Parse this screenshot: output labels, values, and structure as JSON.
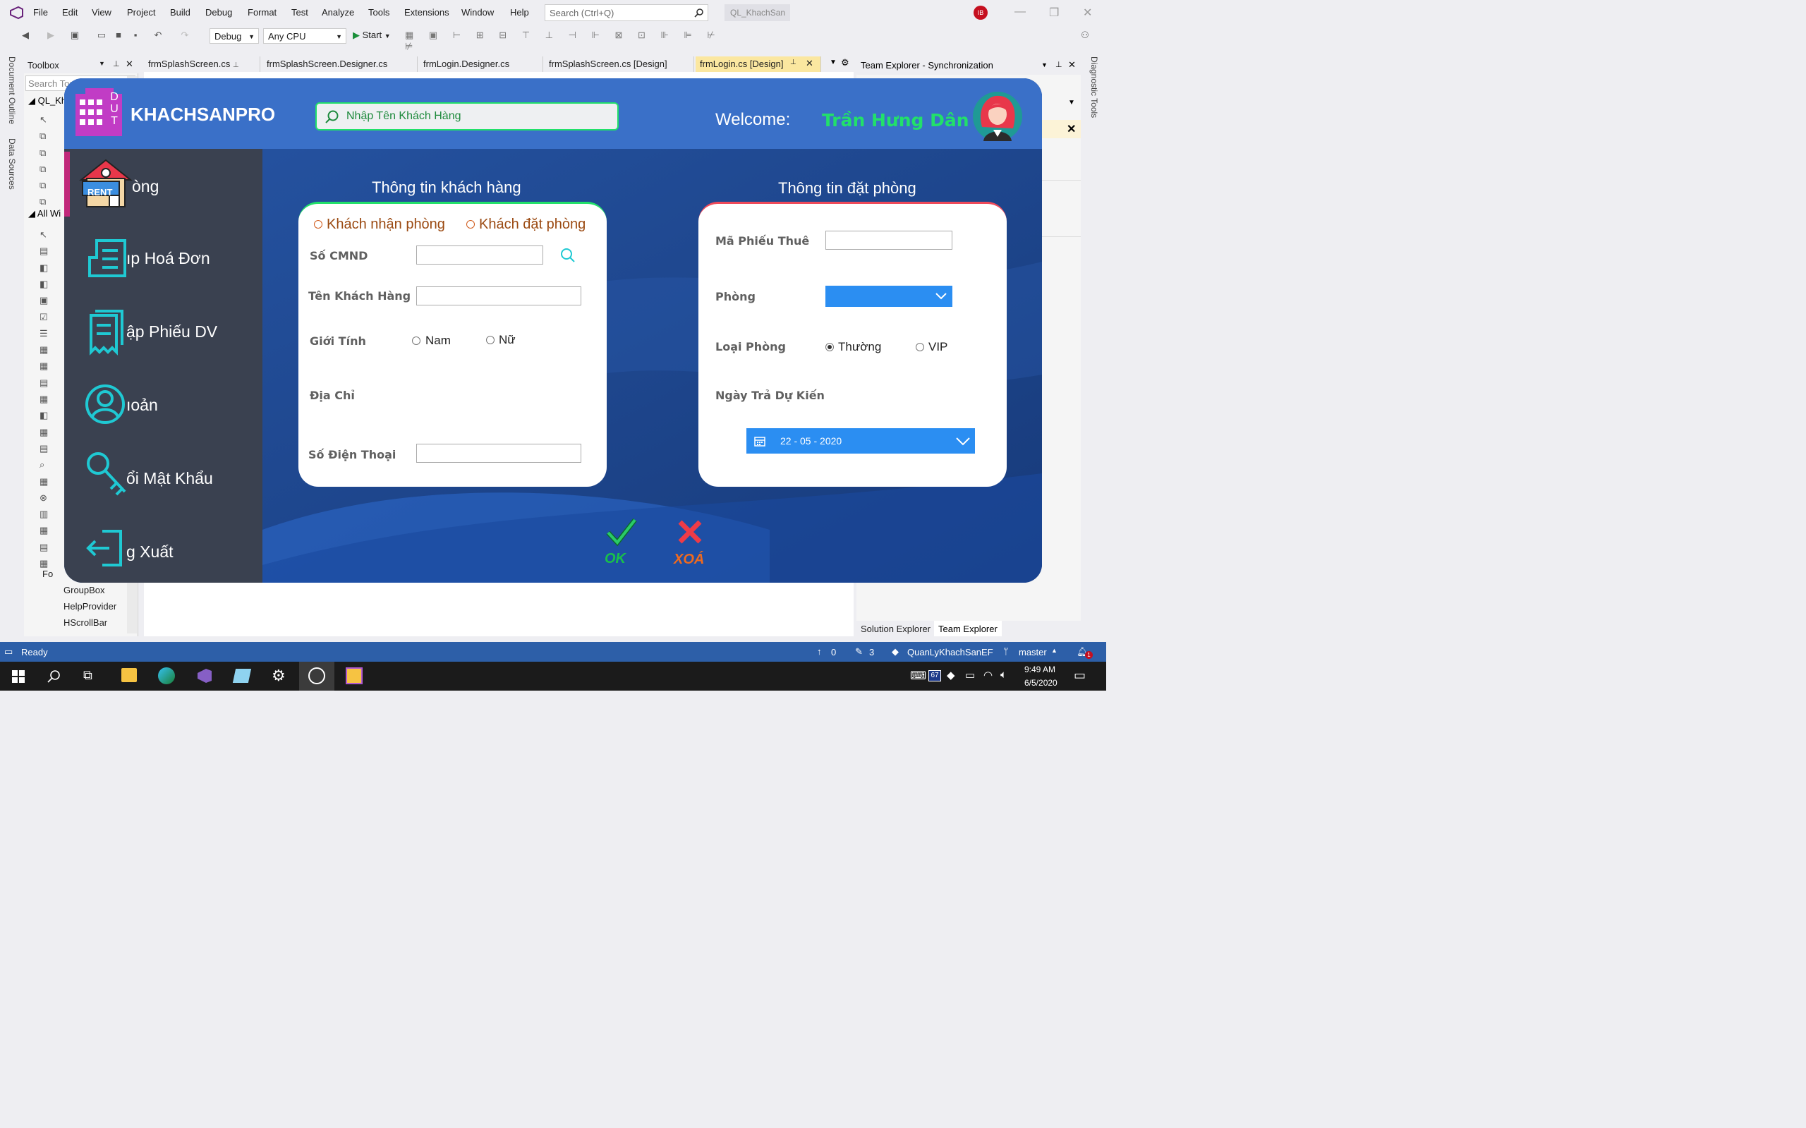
{
  "vs": {
    "menu": [
      "File",
      "Edit",
      "View",
      "Project",
      "Build",
      "Debug",
      "Format",
      "Test",
      "Analyze",
      "Tools",
      "Extensions",
      "Window",
      "Help"
    ],
    "search_placeholder": "Search (Ctrl+Q)",
    "project_name": "QL_KhachSan",
    "account_initials": "IB",
    "config": "Debug",
    "platform": "Any CPU",
    "start_label": "Start",
    "left_rail": [
      "Document Outline",
      "Data Sources"
    ],
    "right_rail": "Diagnostic Tools",
    "toolbox": {
      "title": "Toolbox",
      "search_placeholder": "Search Toolbox",
      "group1": "QL_Kh",
      "group2": "All Wi",
      "items": [
        "Fo",
        "GroupBox",
        "HelpProvider",
        "HScrollBar"
      ]
    },
    "tabs": [
      "frmSplashScreen.cs",
      "frmSplashScreen.Designer.cs",
      "frmLogin.Designer.cs",
      "frmSplashScreen.cs [Design]",
      "frmLogin.cs [Design]"
    ],
    "team_explorer": {
      "title": "Team Explorer - Synchronization"
    },
    "bottom_tabs": [
      "Solution Explorer",
      "Team Explorer"
    ],
    "status": {
      "ready": "Ready",
      "up_count": "0",
      "edit_count": "3",
      "repo": "QuanLyKhachSanEF",
      "branch": "master",
      "notifications": "1"
    },
    "taskbar": {
      "time": "9:49 AM",
      "date": "6/5/2020",
      "badge": "67"
    }
  },
  "form": {
    "brand": "KHACHSANPRO",
    "logo_letters": "DUT",
    "search_placeholder": "Nhập Tên Khách Hàng",
    "welcome_label": "Welcome:",
    "user_name": "Trần Hưng Dân",
    "nav": [
      {
        "label": "òng",
        "icon": "rent-house-icon",
        "badge": "RENT"
      },
      {
        "label": "ıp Hoá Đơn",
        "icon": "invoice-icon"
      },
      {
        "label": "ập Phiếu DV",
        "icon": "receipt-icon"
      },
      {
        "label": "ıoản",
        "icon": "account-icon"
      },
      {
        "label": "ổi Mật Khẩu",
        "icon": "key-icon"
      },
      {
        "label": "g Xuất",
        "icon": "logout-icon"
      }
    ],
    "customer": {
      "title": "Thông tin khách hàng",
      "radio_checkin": "Khách nhận phòng",
      "radio_booking": "Khách đặt phòng",
      "cmnd_label": "Số CMND",
      "name_label": "Tên Khách Hàng",
      "gender_label": "Giới Tính",
      "male": "Nam",
      "female": "Nữ",
      "address_label": "Địa Chỉ",
      "phone_label": "Số Điện Thoại"
    },
    "booking": {
      "title": "Thông tin đặt phòng",
      "slip_label": "Mã Phiếu Thuê",
      "room_label": "Phòng",
      "room_type_label": "Loại Phòng",
      "normal": "Thường",
      "vip": "VIP",
      "return_label": "Ngày Trả Dự Kiến",
      "date": "22 - 05 - 2020"
    },
    "ok_label": "OK",
    "delete_label": "XOÁ",
    "colors": {
      "accent_green": "#22e06a",
      "header_blue": "#3a70c8",
      "sidebar": "#3a4150",
      "date_blue": "#2b8ef2",
      "ok": "#19c04a",
      "delete": "#f06a1e"
    }
  }
}
